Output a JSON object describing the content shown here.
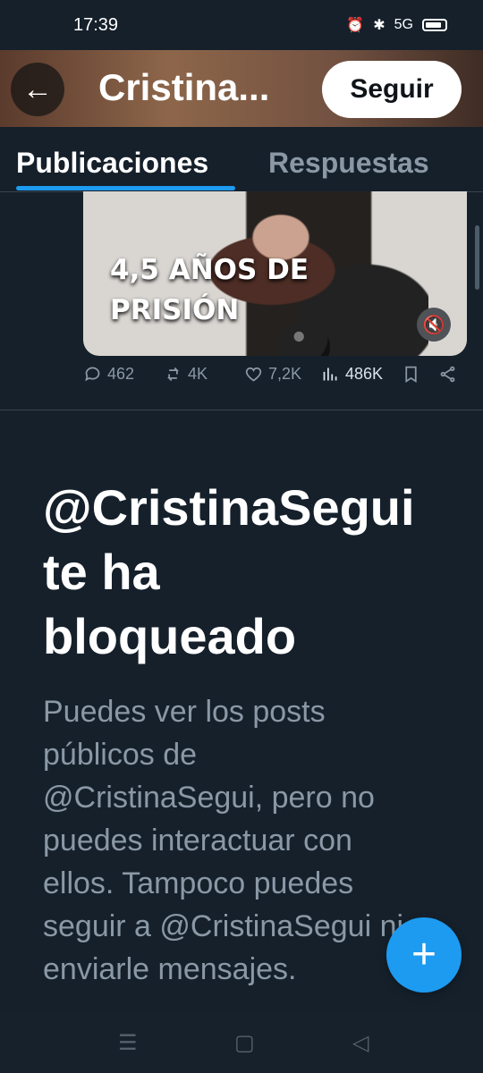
{
  "status": {
    "time": "17:39",
    "icons": [
      "alarm-icon",
      "bluetooth-icon",
      "signal-5g-icon",
      "battery-icon"
    ],
    "network": "5G"
  },
  "header": {
    "title": "Cristina...",
    "follow_label": "Seguir",
    "back_icon": "arrow-left-icon"
  },
  "tabs": [
    {
      "label": "Publicaciones",
      "active": true
    },
    {
      "label": "Respuestas",
      "active": false
    }
  ],
  "post": {
    "media_caption": "4,5 AÑOS DE PRISIÓN",
    "metrics": {
      "replies": "462",
      "reposts": "4K",
      "likes": "7,2K",
      "views": "486K"
    }
  },
  "blocked": {
    "title": "@CristinaSegui te ha bloqueado",
    "description": "Puedes ver los posts públicos de @CristinaSegui, pero no puedes interactuar con ellos. Tampoco puedes seguir a @CristinaSegui ni enviarle mensajes."
  },
  "fab": {
    "label": "+"
  },
  "colors": {
    "background": "#15202b",
    "accent": "#1d9bf0",
    "muted_text": "#8b98a5",
    "border": "#38444d"
  }
}
